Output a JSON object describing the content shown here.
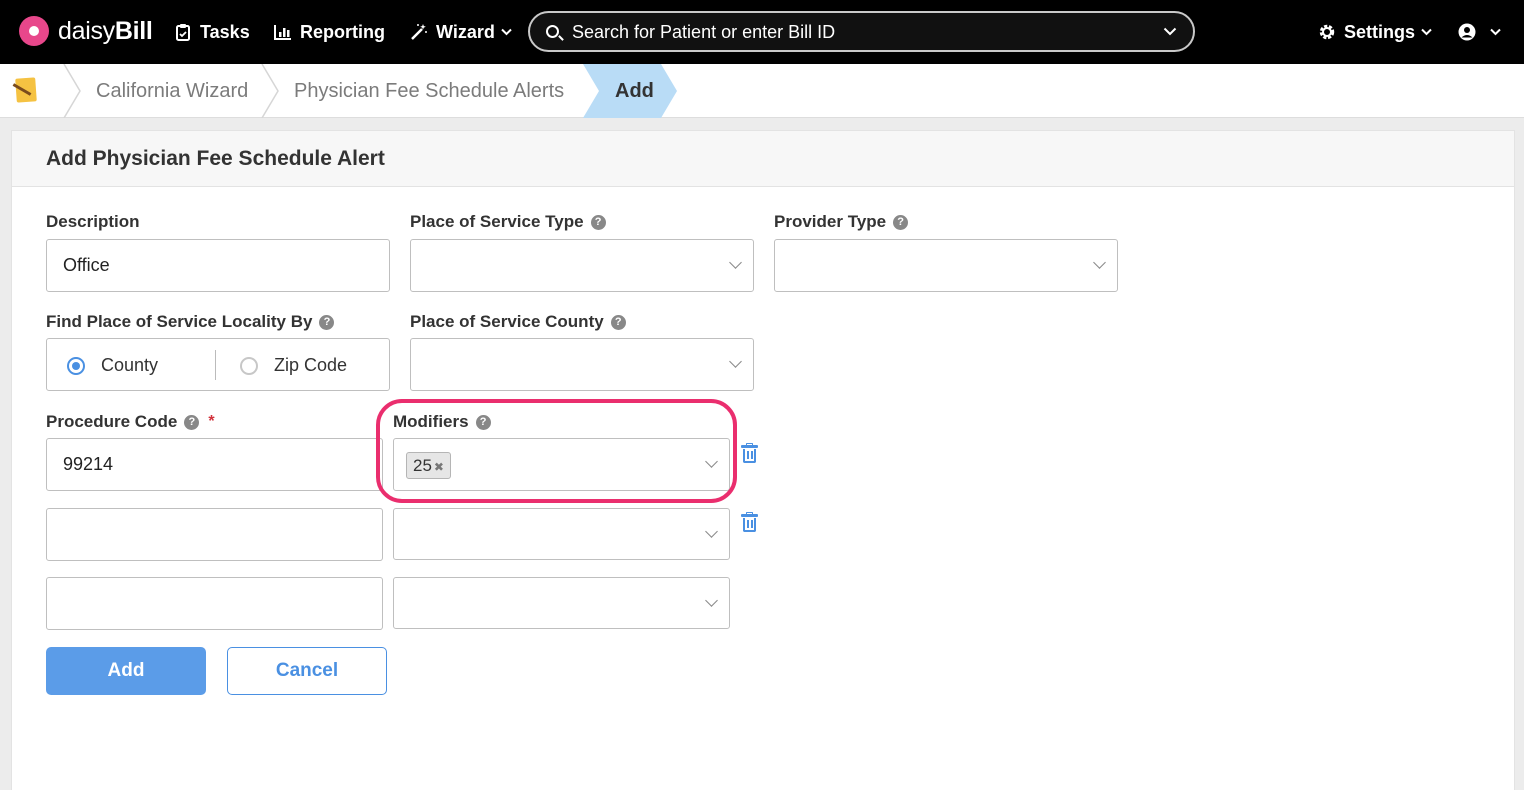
{
  "topnav": {
    "logo_thin": "daisy",
    "logo_bold": "Bill",
    "tasks": "Tasks",
    "reporting": "Reporting",
    "wizard": "Wizard",
    "search_placeholder": "Search for Patient or enter Bill ID",
    "settings": "Settings"
  },
  "breadcrumb": {
    "items": [
      "California Wizard",
      "Physician Fee Schedule Alerts",
      "Add"
    ]
  },
  "form": {
    "title": "Add Physician Fee Schedule Alert",
    "description_label": "Description",
    "description_value": "Office",
    "pos_type_label": "Place of Service Type",
    "pos_type_value": "",
    "provider_type_label": "Provider Type",
    "provider_type_value": "",
    "locality_label": "Find Place of Service Locality By",
    "locality_options": [
      "County",
      "Zip Code"
    ],
    "locality_selected": "County",
    "county_label": "Place of Service County",
    "county_value": "",
    "procedure_label": "Procedure Code",
    "required_mark": "*",
    "modifiers_label": "Modifiers",
    "rows": [
      {
        "procedure": "99214",
        "modifiers": [
          "25"
        ]
      },
      {
        "procedure": "",
        "modifiers": []
      },
      {
        "procedure": "",
        "modifiers": []
      }
    ],
    "add_button": "Add",
    "cancel_button": "Cancel"
  },
  "colors": {
    "accent": "#4a90e2",
    "highlight": "#ea2e6e",
    "nav_bg": "#000000"
  },
  "icons": [
    "daisy-logo-icon",
    "clipboard-icon",
    "bar-chart-icon",
    "magic-wand-icon",
    "search-icon",
    "chevron-down-icon",
    "gear-icon",
    "user-circle-icon",
    "wizard-book-icon",
    "help-icon",
    "trash-icon"
  ]
}
